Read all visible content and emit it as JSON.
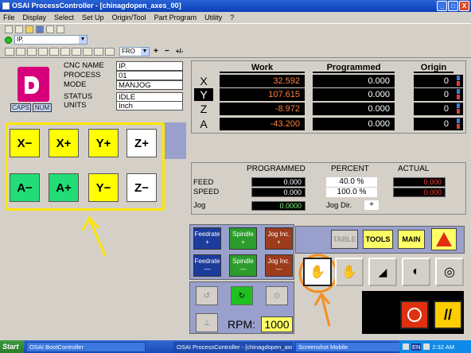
{
  "window": {
    "title": "OSAI ProcessController - [chinagdopen_axes_00]",
    "controls": [
      "_",
      "□",
      "X"
    ]
  },
  "menu": {
    "items": [
      "File",
      "Display",
      "Select",
      "Set Up",
      "Origin/Tool",
      "Part Program",
      "Utility",
      "?"
    ]
  },
  "toolbar2": {
    "process_select": "IP."
  },
  "toolbar3": {
    "override_select": "FRO",
    "plus_label": "+",
    "minus_label": "−",
    "step_label": "+/-"
  },
  "status": {
    "caps": "CAPS",
    "num": "NUM",
    "fields": [
      {
        "label": "CNC NAME",
        "value": "IP."
      },
      {
        "label": "PROCESS",
        "value": "01"
      },
      {
        "label": "MODE",
        "value": "MANJOG"
      },
      {
        "label": "STATUS",
        "value": "IDLE"
      },
      {
        "label": "UNITS",
        "value": "Inch"
      }
    ]
  },
  "axes": {
    "headers": {
      "work": "Work",
      "programmed": "Programmed",
      "origin": "Origin"
    },
    "rows": [
      {
        "name": "X",
        "work": "32.592",
        "programmed": "0.000",
        "origin": "0"
      },
      {
        "name": "Y",
        "work": "107.615",
        "programmed": "0.000",
        "origin": "0"
      },
      {
        "name": "Z",
        "work": "-8.972",
        "programmed": "0.000",
        "origin": "0"
      },
      {
        "name": "A",
        "work": "-43.200",
        "programmed": "0.000",
        "origin": "0"
      }
    ],
    "selected": "Y"
  },
  "jog": {
    "buttons": [
      {
        "label": "X−",
        "color": "#ffff00"
      },
      {
        "label": "X+",
        "color": "#ffff00"
      },
      {
        "label": "Y+",
        "color": "#ffff00"
      },
      {
        "label": "Z+",
        "color": "#ffffff"
      },
      {
        "label": "A−",
        "color": "#22dd77"
      },
      {
        "label": "A+",
        "color": "#22dd77"
      },
      {
        "label": "Y−",
        "color": "#ffff00"
      },
      {
        "label": "Z−",
        "color": "#ffffff"
      }
    ]
  },
  "feed": {
    "headers": {
      "programmed": "PROGRAMMED",
      "percent": "PERCENT",
      "actual": "ACTUAL"
    },
    "feed": {
      "label": "FEED",
      "programmed": "0.000",
      "percent": "40.0 %",
      "actual": "0.000"
    },
    "speed": {
      "label": "SPEED",
      "programmed": "0.000",
      "percent": "100.0 %",
      "actual": "0.000"
    },
    "jog": {
      "label": "Jog",
      "value": "0.0000"
    },
    "jog_dir": {
      "label": "Jog Dir.",
      "value": "+"
    }
  },
  "overrides": {
    "row1": [
      {
        "line1": "Feedrate",
        "line2": "+"
      },
      {
        "line1": "Spindle",
        "line2": "+"
      },
      {
        "line1": "Jog Inc.",
        "line2": "+"
      }
    ],
    "row2": [
      {
        "line1": "Feedrate",
        "line2": "—"
      },
      {
        "line1": "Spindle",
        "line2": "—"
      },
      {
        "line1": "Jog Inc.",
        "line2": "—"
      }
    ]
  },
  "modes": {
    "table": "TABLE",
    "tools": "TOOLS",
    "main": "MAIN"
  },
  "spindle": {
    "rpm_label": "RPM:",
    "rpm_value": "1000"
  },
  "taskbar": {
    "start": "Start",
    "tasks": [
      "OSAI BootController",
      "OSAI ProcessController - [chinagdopen_axes...",
      "Screenshot Mobile"
    ],
    "lang": "EN",
    "time": "2:32 AM"
  },
  "colors": {
    "jog_highlight": "#ffe600",
    "annotation": "#f39020",
    "logo": "#d8007a"
  }
}
